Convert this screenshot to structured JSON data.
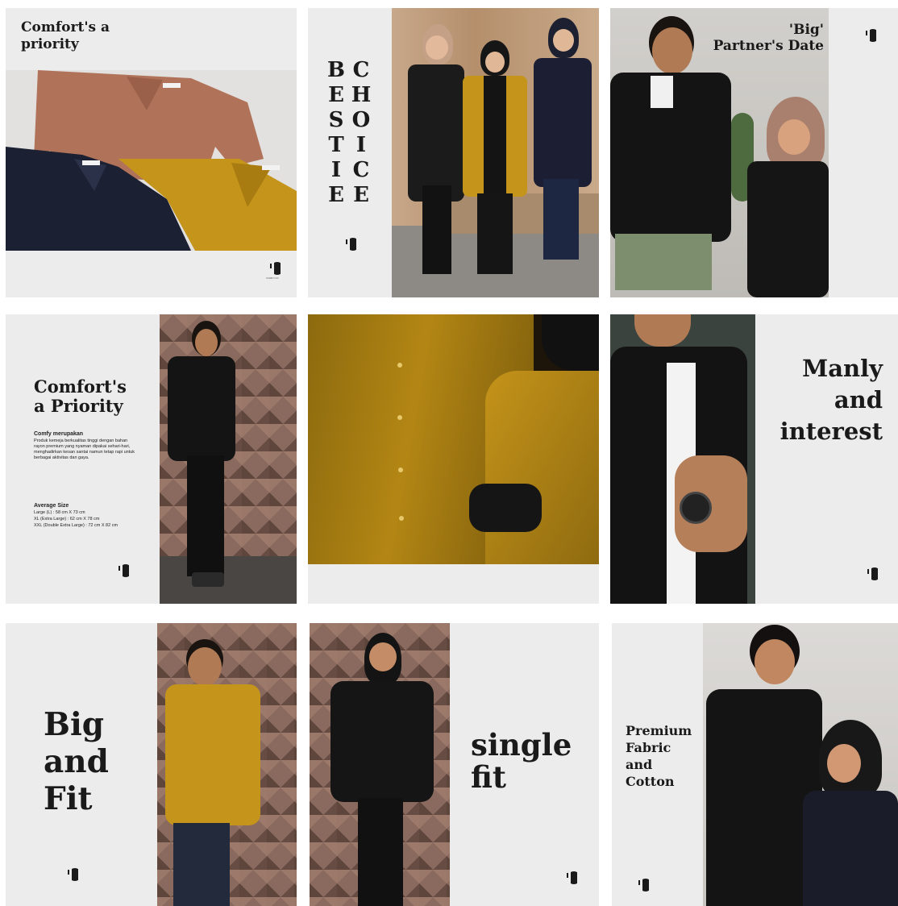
{
  "tiles": {
    "t1": {
      "title": "Comfort's a\npriority"
    },
    "t2": {
      "vertical_col1": "B\nE\nS\nT\nI\nE",
      "vertical_col2": "C\nH\nO\nI\nC\nE"
    },
    "t3": {
      "title_line1": "'Big'",
      "title_line2": "Partner's Date"
    },
    "t4": {
      "title": "Comfort's\na Priority",
      "body_heading": "Comfy merupakan",
      "body_text": "Produk kemeja berkualitas tinggi dengan bahan rayon premium yang nyaman dipakai sehari-hari, menghadirkan kesan santai namun tetap rapi untuk berbagai aktivitas dan gaya.",
      "size_heading": "Average Size",
      "size_lines": [
        "Large (L) : 58 cm X 73 cm",
        "XL (Extra Large) : 62 cm X 78 cm",
        "XXL (Double Extra Large) : 72 cm X 82 cm"
      ]
    },
    "t6": {
      "title": "Manly\nand\ninterest"
    },
    "t7": {
      "title": "Big\nand\nFit"
    },
    "t8": {
      "title": "single\nfit"
    },
    "t9": {
      "title": "Premium\nFabric\nand\nCotton"
    }
  },
  "brand": {
    "logo_icon": "brand-logo-icon",
    "logo_caption": "COMFY.CO"
  },
  "colors": {
    "tile_bg": "#ececec",
    "mustard": "#c5951b",
    "terracotta": "#b0735a",
    "navy": "#1c2033",
    "black_shirt": "#151515",
    "brick": "#8a6a5e"
  }
}
